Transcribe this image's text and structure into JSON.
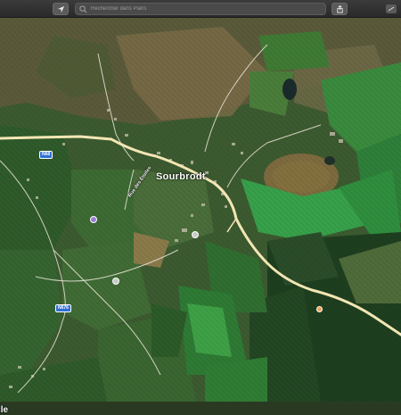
{
  "toolbar": {
    "search_placeholder": "Rechercher dans Plans",
    "locate_icon": "location-arrow-icon",
    "share_icon": "share-icon",
    "corner_icon": "window-corner-icon"
  },
  "map": {
    "town_label": "Sourbrodt",
    "street_label": "Rue des Étoiles",
    "edge_label": "lle",
    "road_shields": [
      "N68",
      "N676"
    ],
    "colors": {
      "forest": "#1f4a22",
      "field_green": "#3f7a34",
      "bright_green": "#37a04a",
      "heath": "#6b6a45",
      "road": "#f3e6b4"
    }
  }
}
